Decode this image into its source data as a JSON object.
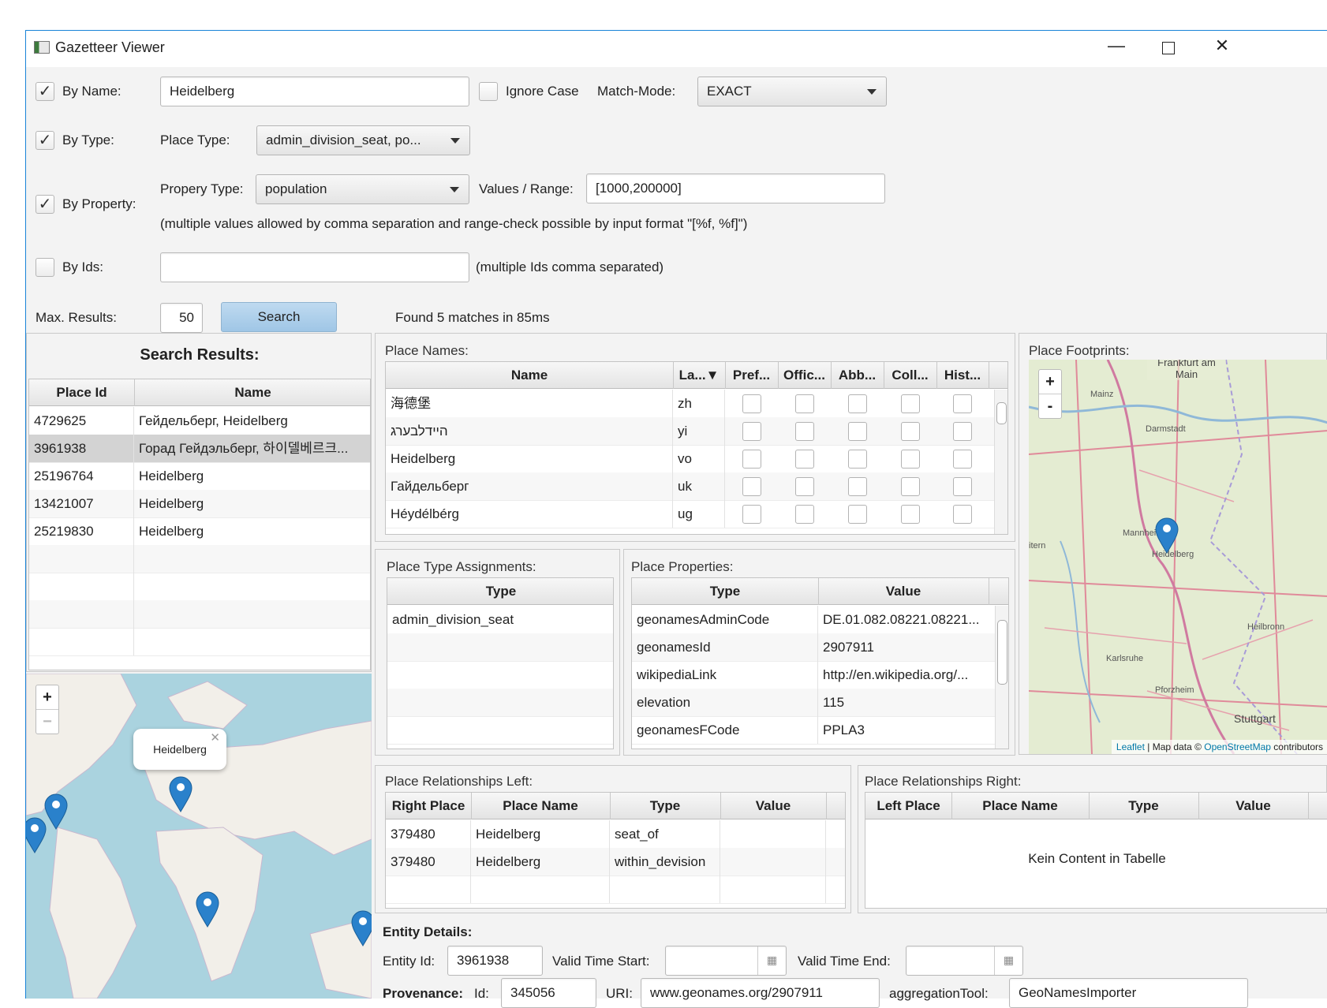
{
  "window": {
    "title": "Gazetteer Viewer"
  },
  "filters": {
    "by_name": {
      "label": "By Name:",
      "checked": true,
      "value": "Heidelberg"
    },
    "ignore_case": {
      "label": "Ignore Case",
      "checked": false
    },
    "match_mode": {
      "label": "Match-Mode:",
      "value": "EXACT"
    },
    "by_type": {
      "label": "By Type:",
      "checked": true
    },
    "place_type": {
      "label": "Place Type:",
      "value": "admin_division_seat, po..."
    },
    "by_property": {
      "label": "By Property:",
      "checked": true
    },
    "property_type": {
      "label": "Propery Type:",
      "value": "population"
    },
    "values_range": {
      "label": "Values / Range:",
      "value": "[1000,200000]"
    },
    "property_hint": "(multiple values allowed by comma separation and range-check possible by input format \"[%f, %f]\")",
    "by_ids": {
      "label": "By Ids:",
      "checked": false,
      "value": "",
      "hint": "(multiple Ids comma separated)"
    },
    "max_results": {
      "label": "Max. Results:",
      "value": "50"
    },
    "search_button": "Search",
    "status": "Found 5 matches in 85ms"
  },
  "search_results": {
    "title": "Search Results:",
    "columns": [
      "Place Id",
      "Name"
    ],
    "rows": [
      {
        "id": "4729625",
        "name": "Гейдельберг, Heidelberg"
      },
      {
        "id": "3961938",
        "name": "Горад Гейдэльберг, 하이델베르크..."
      },
      {
        "id": "25196764",
        "name": "Heidelberg"
      },
      {
        "id": "13421007",
        "name": "Heidelberg"
      },
      {
        "id": "25219830",
        "name": "Heidelberg"
      }
    ],
    "selected_index": 1
  },
  "world_map": {
    "popup": "Heidelberg",
    "zoom_in": "+",
    "zoom_out": "−"
  },
  "place_names": {
    "title": "Place Names:",
    "columns": [
      "Name",
      "La...▼",
      "Pref...",
      "Offic...",
      "Abb...",
      "Coll...",
      "Hist..."
    ],
    "rows": [
      {
        "name": "海德堡",
        "lang": "zh"
      },
      {
        "name": "הײדלבערג",
        "lang": "yi"
      },
      {
        "name": "Heidelberg",
        "lang": "vo"
      },
      {
        "name": "Гайдельберг",
        "lang": "uk"
      },
      {
        "name": "Héydélbérg",
        "lang": "ug"
      }
    ]
  },
  "place_footprints": {
    "title": "Place Footprints:",
    "zoom_in": "+",
    "zoom_out": "-",
    "attribution": {
      "leaflet": "Leaflet",
      "middle": " | Map data © ",
      "osm": "OpenStreetMap",
      "end": " contributors"
    },
    "cities": [
      "Frankfurt am Main",
      "Mainz",
      "Darmstadt",
      "Mannheim",
      "Heidelberg",
      "Heilbronn",
      "Karlsruhe",
      "Pforzheim",
      "Stuttgart"
    ],
    "edge_label": "itern"
  },
  "type_assignments": {
    "title": "Place Type Assignments:",
    "columns": [
      "Type"
    ],
    "rows": [
      "admin_division_seat"
    ]
  },
  "place_properties": {
    "title": "Place Properties:",
    "columns": [
      "Type",
      "Value"
    ],
    "rows": [
      {
        "type": "geonamesAdminCode",
        "value": "DE.01.082.08221.08221..."
      },
      {
        "type": "geonamesId",
        "value": "2907911"
      },
      {
        "type": "wikipediaLink",
        "value": "http://en.wikipedia.org/..."
      },
      {
        "type": "elevation",
        "value": "115"
      },
      {
        "type": "geonamesFCode",
        "value": "PPLA3"
      }
    ]
  },
  "rel_left": {
    "title": "Place Relationships Left:",
    "columns": [
      "Right Place",
      "Place Name",
      "Type",
      "Value"
    ],
    "rows": [
      {
        "place": "379480",
        "name": "Heidelberg",
        "type": "seat_of",
        "value": ""
      },
      {
        "place": "379480",
        "name": "Heidelberg",
        "type": "within_devision",
        "value": ""
      }
    ]
  },
  "rel_right": {
    "title": "Place Relationships Right:",
    "columns": [
      "Left Place",
      "Place Name",
      "Type",
      "Value"
    ],
    "empty": "Kein Content in Tabelle"
  },
  "entity_details": {
    "title": "Entity Details:",
    "entity_id_label": "Entity Id:",
    "entity_id": "3961938",
    "valid_start_label": "Valid Time Start:",
    "valid_end_label": "Valid Time End:",
    "provenance_label": "Provenance:",
    "prov_id_label": "Id:",
    "prov_id": "345056",
    "uri_label": "URI:",
    "uri": "www.geonames.org/2907911",
    "tool_label": "aggregationTool:",
    "tool": "GeoNamesImporter"
  }
}
